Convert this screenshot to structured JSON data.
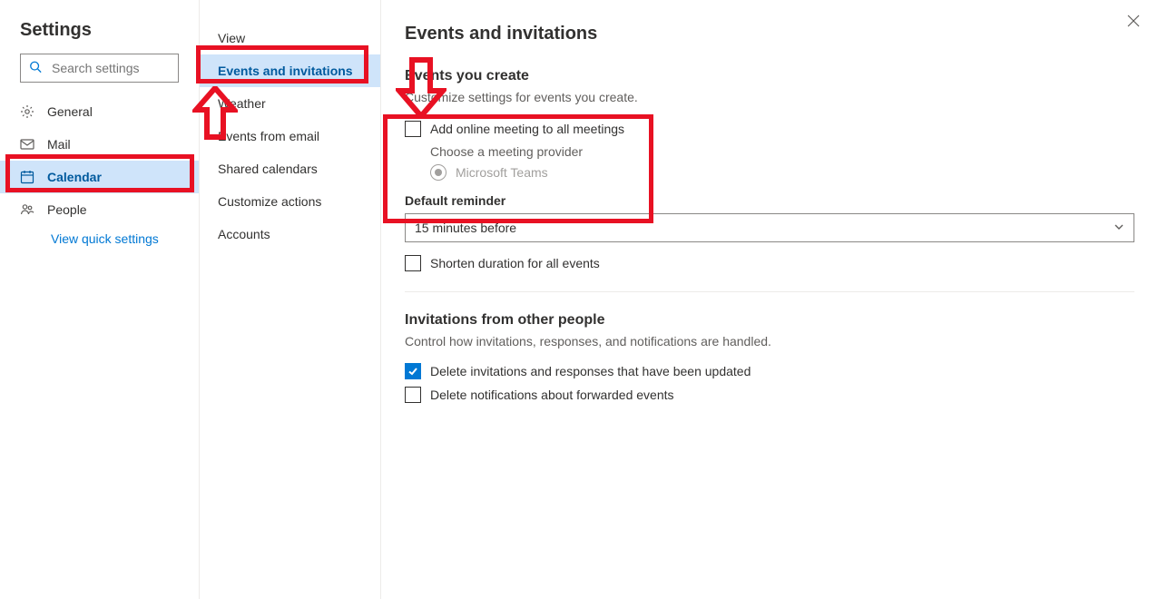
{
  "header": {
    "title": "Settings"
  },
  "search": {
    "placeholder": "Search settings"
  },
  "nav": {
    "general": "General",
    "mail": "Mail",
    "calendar": "Calendar",
    "people": "People",
    "quick_settings": "View quick settings"
  },
  "mid": {
    "view": "View",
    "events_invitations": "Events and invitations",
    "weather": "Weather",
    "events_email": "Events from email",
    "shared_calendars": "Shared calendars",
    "customize_actions": "Customize actions",
    "accounts": "Accounts"
  },
  "main": {
    "title": "Events and invitations",
    "section1_head": "Events you create",
    "section1_sub": "Customize settings for events you create.",
    "add_online_label": "Add online meeting to all meetings",
    "choose_provider": "Choose a meeting provider",
    "provider_teams": "Microsoft Teams",
    "default_reminder_label": "Default reminder",
    "default_reminder_value": "15 minutes before",
    "shorten_label": "Shorten duration for all events",
    "section2_head": "Invitations from other people",
    "section2_sub": "Control how invitations, responses, and notifications are handled.",
    "delete_invitations_label": "Delete invitations and responses that have been updated",
    "delete_notifications_label": "Delete notifications about forwarded events"
  },
  "state": {
    "add_online_checked": false,
    "shorten_checked": false,
    "delete_invitations_checked": true,
    "delete_notifications_checked": false
  },
  "colors": {
    "accent": "#0078d4",
    "selection_bg": "#cfe4fa",
    "annotation": "#e81123"
  }
}
